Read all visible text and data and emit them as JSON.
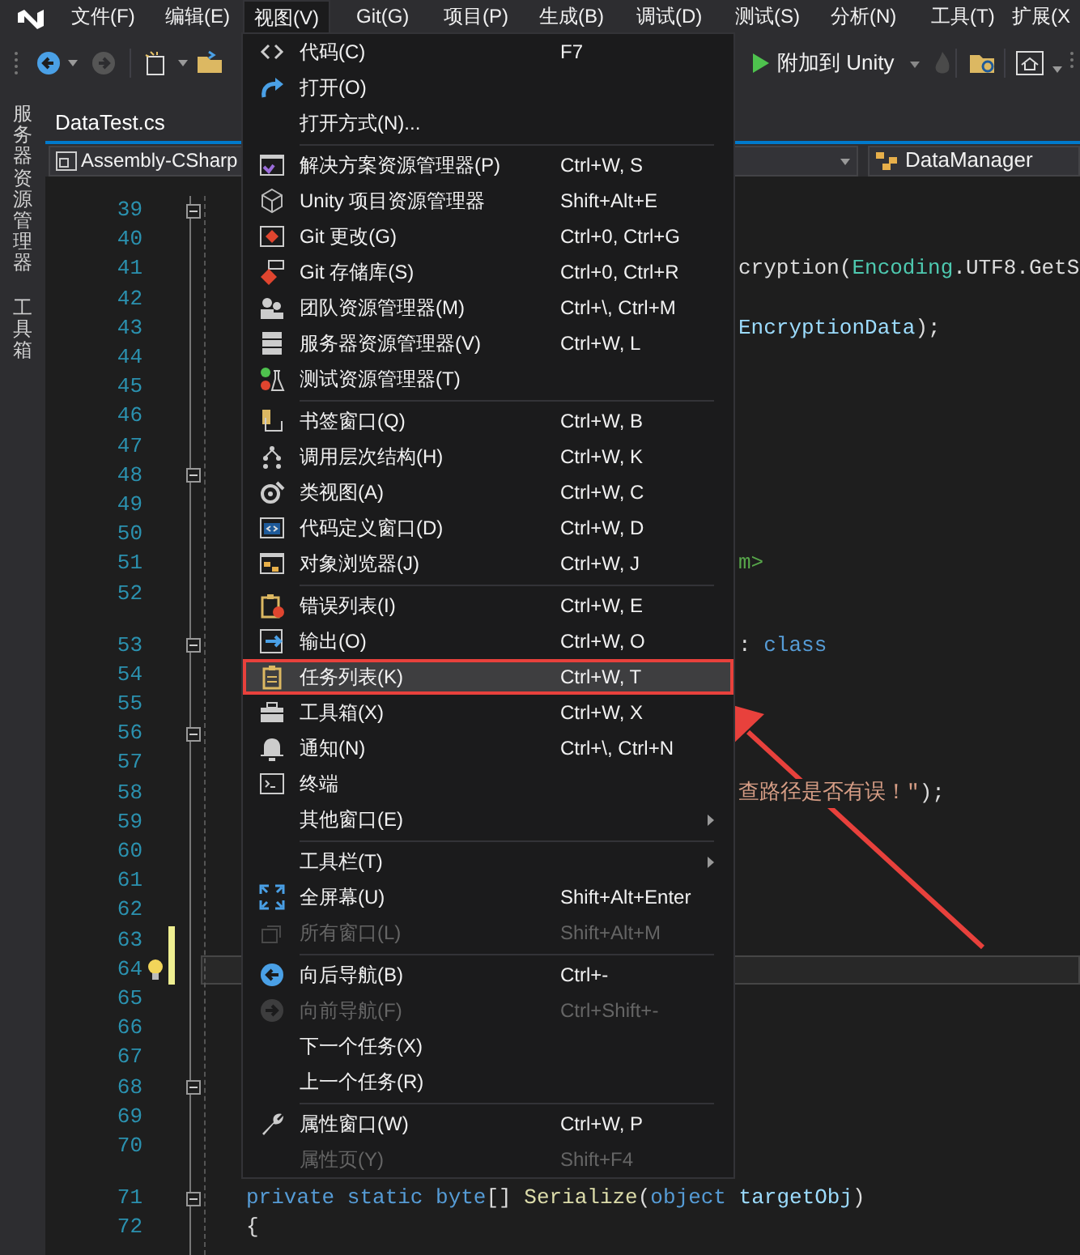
{
  "menu_bar": [
    {
      "label": "文件(F)",
      "selected": false
    },
    {
      "label": "编辑(E)",
      "selected": false
    },
    {
      "label": "视图(V)",
      "selected": true
    },
    {
      "label": "Git(G)",
      "selected": false
    },
    {
      "label": "项目(P)",
      "selected": false
    },
    {
      "label": "生成(B)",
      "selected": false
    },
    {
      "label": "调试(D)",
      "selected": false
    },
    {
      "label": "测试(S)",
      "selected": false
    },
    {
      "label": "分析(N)",
      "selected": false
    },
    {
      "label": "工具(T)",
      "selected": false
    },
    {
      "label": "扩展(X",
      "selected": false
    }
  ],
  "toolbar": {
    "attach_button": "附加到 Unity"
  },
  "side_strip": [
    {
      "label": "服务器资源管理器"
    },
    {
      "label": "工具箱"
    }
  ],
  "document_tab": {
    "label": "DataTest.cs"
  },
  "navigation_bar": {
    "project": "Assembly-CSharp",
    "type": "DataManager"
  },
  "editor": {
    "lines": [
      {
        "number": "39",
        "fold": true
      },
      {
        "number": "40"
      },
      {
        "number": "41",
        "clipped": true,
        "tokens": [
          {
            "text": "cryption(",
            "kind": "plain"
          },
          {
            "text": "Encoding",
            "kind": "type"
          },
          {
            "text": ".UTF8.GetS",
            "kind": "plain"
          }
        ]
      },
      {
        "number": "42"
      },
      {
        "number": "43",
        "clipped": true,
        "tokens": [
          {
            "text": "EncryptionData",
            "kind": "variable"
          },
          {
            "text": ");",
            "kind": "plain"
          }
        ]
      },
      {
        "number": "44"
      },
      {
        "number": "45"
      },
      {
        "number": "46"
      },
      {
        "number": "47"
      },
      {
        "number": "48",
        "fold": true
      },
      {
        "number": "49"
      },
      {
        "number": "50"
      },
      {
        "number": "51",
        "clipped": true,
        "tokens": [
          {
            "text": "m>",
            "kind": "comment"
          }
        ]
      },
      {
        "number": "52"
      },
      {
        "number": "53",
        "fold": true,
        "codelens_above": true,
        "clipped": true,
        "tokens": [
          {
            "text": ": ",
            "kind": "plain"
          },
          {
            "text": "class",
            "kind": "keyword"
          }
        ]
      },
      {
        "number": "54"
      },
      {
        "number": "55"
      },
      {
        "number": "56",
        "fold": true
      },
      {
        "number": "57"
      },
      {
        "number": "58",
        "clipped": true,
        "tokens": [
          {
            "text": "查路径是否有误！\"",
            "kind": "string"
          },
          {
            "text": ");",
            "kind": "plain"
          }
        ]
      },
      {
        "number": "59"
      },
      {
        "number": "60"
      },
      {
        "number": "61"
      },
      {
        "number": "62"
      },
      {
        "number": "63",
        "changed": true
      },
      {
        "number": "64",
        "changed": true,
        "current": true,
        "lightbulb": true
      },
      {
        "number": "65"
      },
      {
        "number": "66"
      },
      {
        "number": "67"
      },
      {
        "number": "68",
        "fold": true
      },
      {
        "number": "69"
      },
      {
        "number": "70"
      },
      {
        "number": "71",
        "fold": true,
        "codelens_above": true,
        "tokens": [
          {
            "text": "private static byte",
            "kind": "keyword"
          },
          {
            "text": "[] ",
            "kind": "plain"
          },
          {
            "text": "Serialize",
            "kind": "method"
          },
          {
            "text": "(",
            "kind": "plain"
          },
          {
            "text": "object",
            "kind": "keyword"
          },
          {
            "text": " targetObj",
            "kind": "variable"
          },
          {
            "text": ")",
            "kind": "plain"
          }
        ]
      },
      {
        "number": "72",
        "tokens": [
          {
            "text": "{",
            "kind": "plain"
          }
        ]
      }
    ]
  },
  "view_menu": {
    "sections": [
      {
        "items": [
          {
            "label": "代码(C)",
            "shortcut": "F7",
            "disabled": false,
            "selected": false
          },
          {
            "label": "打开(O)",
            "disabled": false,
            "selected": false
          },
          {
            "label": "打开方式(N)...",
            "disabled": false,
            "selected": false
          }
        ]
      },
      {
        "items": [
          {
            "label": "解决方案资源管理器(P)",
            "shortcut": "Ctrl+W, S",
            "disabled": false,
            "selected": false
          },
          {
            "label": "Unity 项目资源管理器",
            "shortcut": "Shift+Alt+E",
            "disabled": false,
            "selected": false
          },
          {
            "label": "Git 更改(G)",
            "shortcut": "Ctrl+0, Ctrl+G",
            "disabled": false,
            "selected": false
          },
          {
            "label": "Git 存储库(S)",
            "shortcut": "Ctrl+0, Ctrl+R",
            "disabled": false,
            "selected": false
          },
          {
            "label": "团队资源管理器(M)",
            "shortcut": "Ctrl+\\, Ctrl+M",
            "disabled": false,
            "selected": false
          },
          {
            "label": "服务器资源管理器(V)",
            "shortcut": "Ctrl+W, L",
            "disabled": false,
            "selected": false
          },
          {
            "label": "测试资源管理器(T)",
            "disabled": false,
            "selected": false
          }
        ]
      },
      {
        "items": [
          {
            "label": "书签窗口(Q)",
            "shortcut": "Ctrl+W, B",
            "disabled": false,
            "selected": false
          },
          {
            "label": "调用层次结构(H)",
            "shortcut": "Ctrl+W, K",
            "disabled": false,
            "selected": false
          },
          {
            "label": "类视图(A)",
            "shortcut": "Ctrl+W, C",
            "disabled": false,
            "selected": false
          },
          {
            "label": "代码定义窗口(D)",
            "shortcut": "Ctrl+W, D",
            "disabled": false,
            "selected": false
          },
          {
            "label": "对象浏览器(J)",
            "shortcut": "Ctrl+W, J",
            "disabled": false,
            "selected": false
          }
        ]
      },
      {
        "items": [
          {
            "label": "错误列表(I)",
            "shortcut": "Ctrl+W, E",
            "disabled": false,
            "selected": false
          },
          {
            "label": "输出(O)",
            "shortcut": "Ctrl+W, O",
            "disabled": false,
            "selected": false
          },
          {
            "label": "任务列表(K)",
            "shortcut": "Ctrl+W, T",
            "disabled": false,
            "selected": true
          },
          {
            "label": "工具箱(X)",
            "shortcut": "Ctrl+W, X",
            "disabled": false,
            "selected": false
          },
          {
            "label": "通知(N)",
            "shortcut": "Ctrl+\\, Ctrl+N",
            "disabled": false,
            "selected": false
          },
          {
            "label": "终端",
            "disabled": false,
            "selected": false
          },
          {
            "label": "其他窗口(E)",
            "submenu": true,
            "disabled": false,
            "selected": false
          }
        ]
      },
      {
        "items": [
          {
            "label": "工具栏(T)",
            "submenu": true,
            "disabled": false,
            "selected": false
          },
          {
            "label": "全屏幕(U)",
            "shortcut": "Shift+Alt+Enter",
            "disabled": false,
            "selected": false
          },
          {
            "label": "所有窗口(L)",
            "shortcut": "Shift+Alt+M",
            "disabled": true,
            "selected": false
          }
        ]
      },
      {
        "items": [
          {
            "label": "向后导航(B)",
            "shortcut": "Ctrl+-",
            "disabled": false,
            "selected": false
          },
          {
            "label": "向前导航(F)",
            "shortcut": "Ctrl+Shift+-",
            "disabled": true,
            "selected": false
          },
          {
            "label": "下一个任务(X)",
            "disabled": false,
            "selected": false
          },
          {
            "label": "上一个任务(R)",
            "disabled": false,
            "selected": false
          }
        ]
      },
      {
        "items": [
          {
            "label": "属性窗口(W)",
            "shortcut": "Ctrl+W, P",
            "disabled": false,
            "selected": false
          },
          {
            "label": "属性页(Y)",
            "shortcut": "Shift+F4",
            "disabled": true,
            "selected": false
          }
        ]
      }
    ]
  }
}
